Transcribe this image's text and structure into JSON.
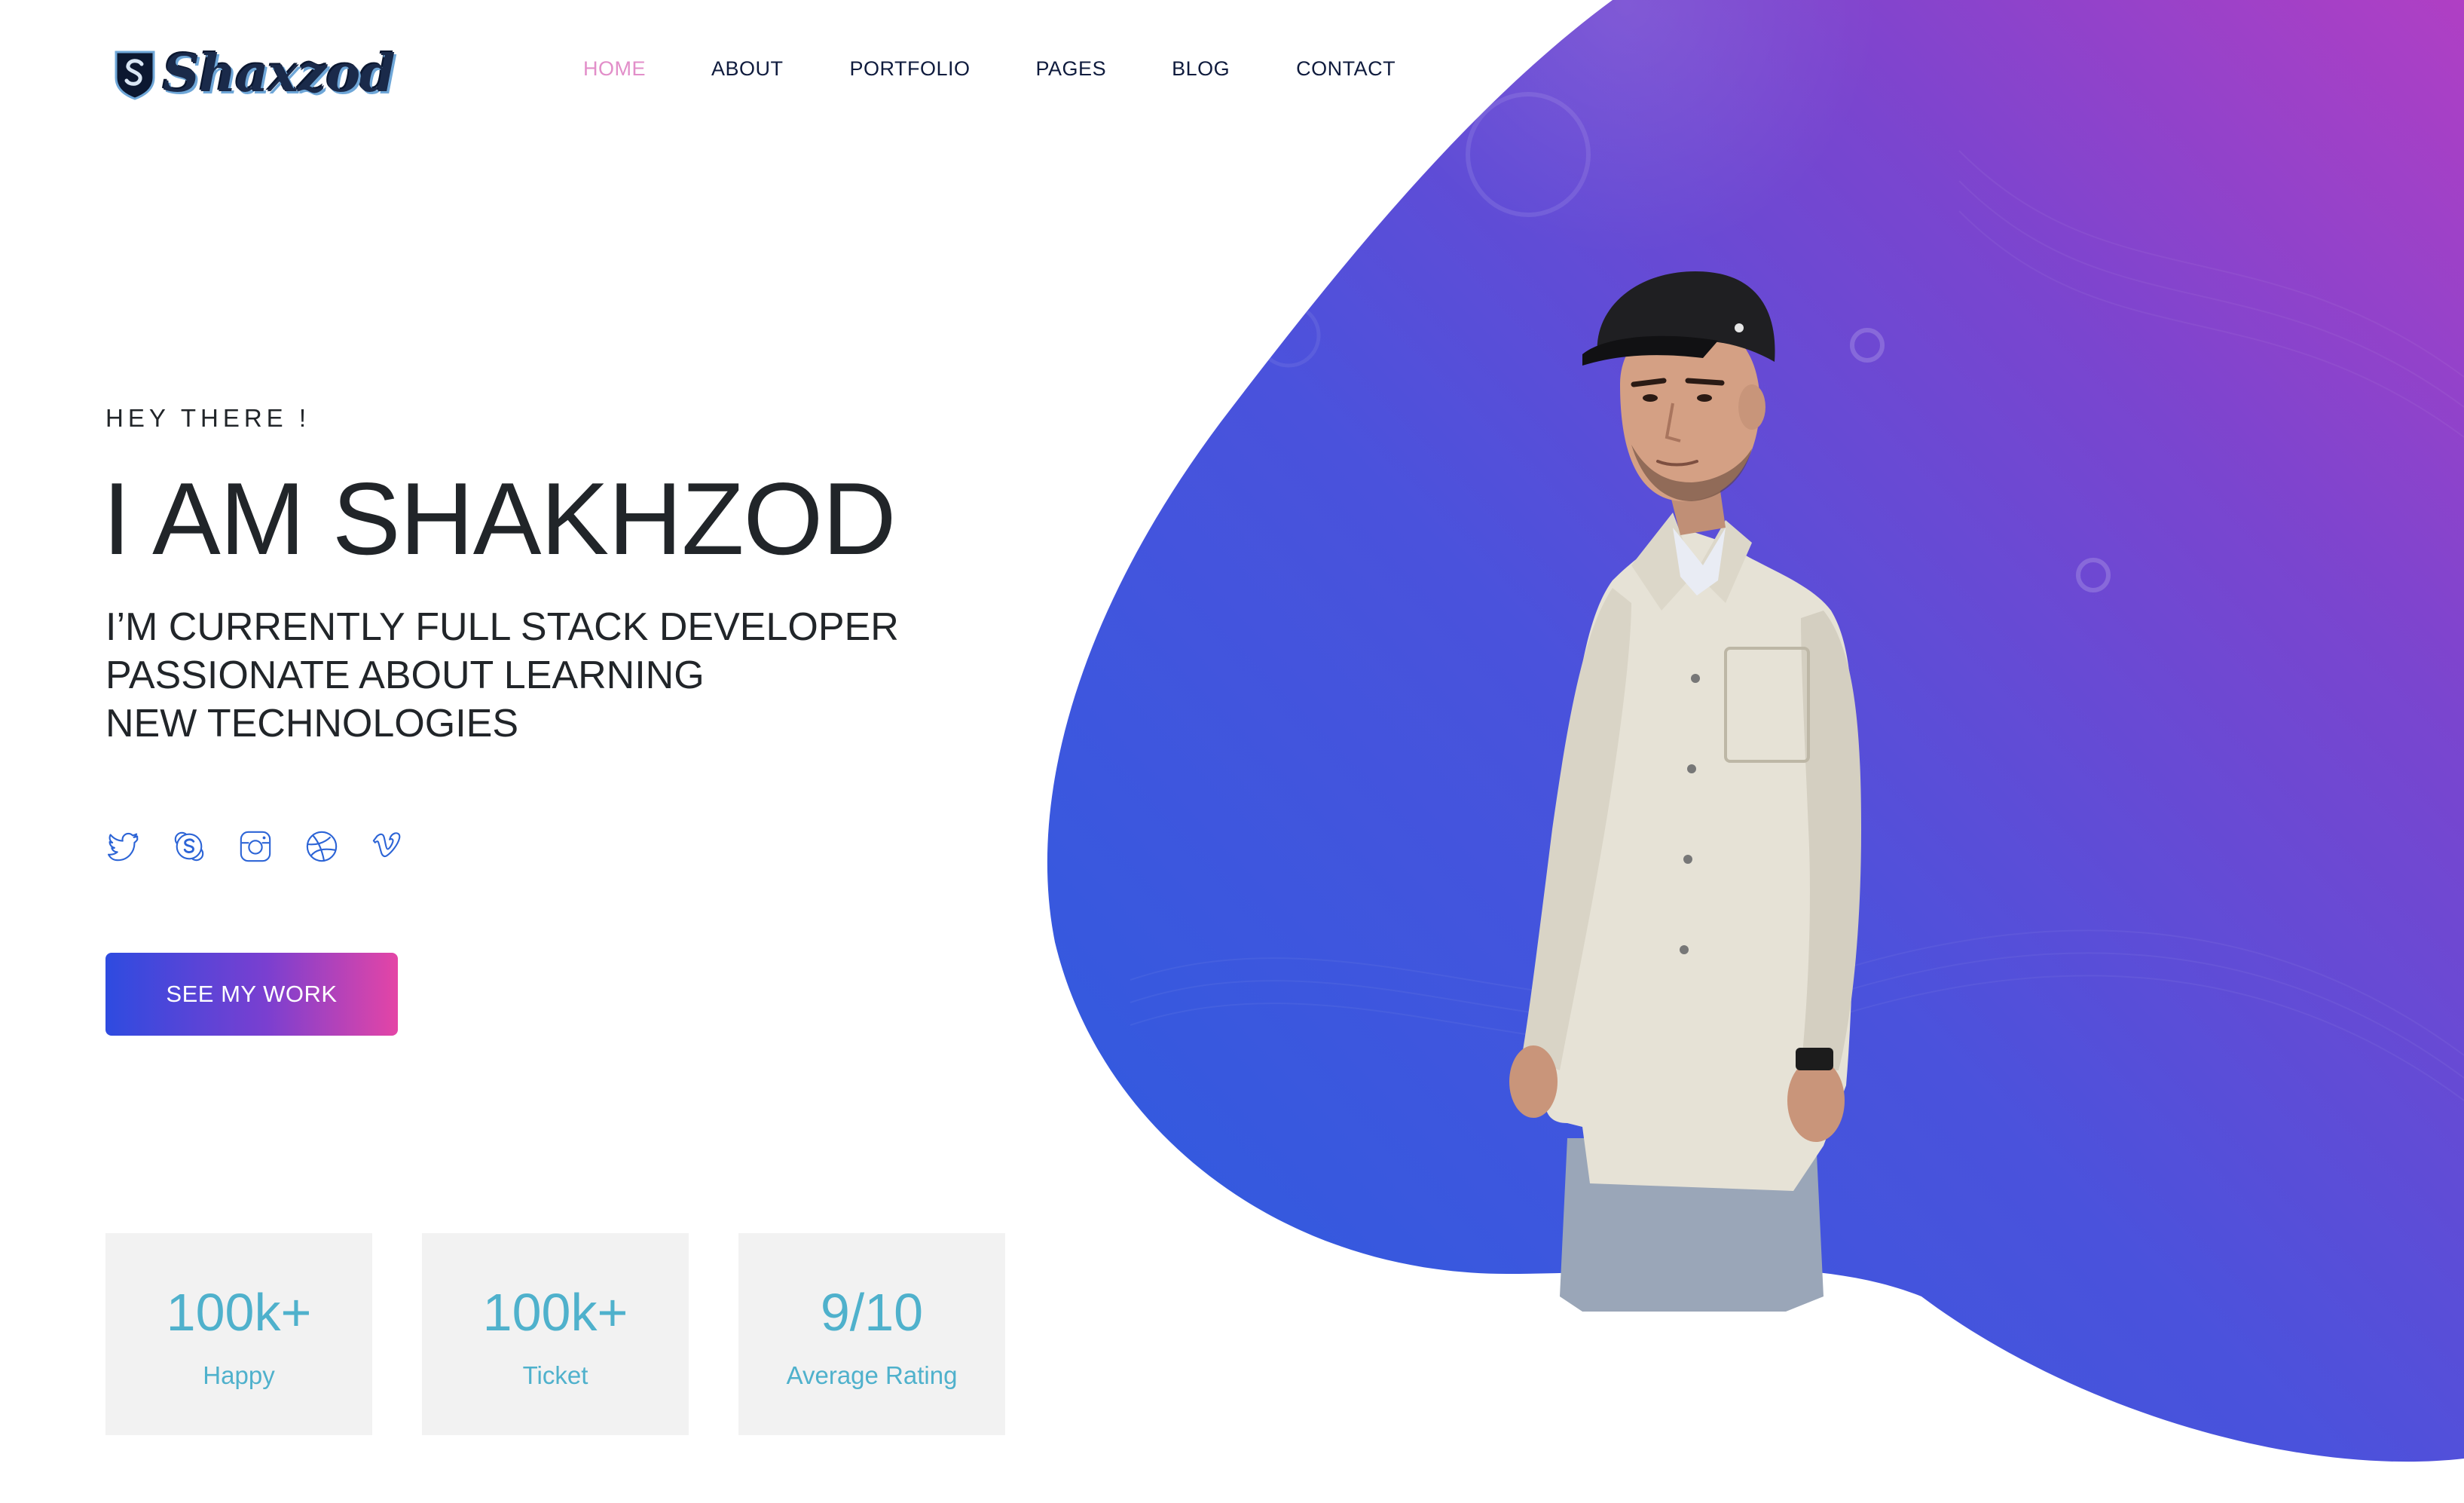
{
  "brand": {
    "name": "Shaxzod",
    "colors": {
      "accent_pink": "#e28ec9",
      "gradient_start": "#2a5de0",
      "gradient_end": "#b03fc4",
      "stat_text": "#4fb1cc",
      "stat_bg": "#f2f2f2"
    }
  },
  "nav": {
    "items": [
      {
        "label": "HOME",
        "active": true
      },
      {
        "label": "ABOUT"
      },
      {
        "label": "PORTFOLIO"
      },
      {
        "label": "PAGES"
      },
      {
        "label": "BLOG"
      },
      {
        "label": "CONTACT"
      }
    ]
  },
  "hero": {
    "eyebrow": "HEY THERE !",
    "headline": "I AM SHAKHZOD",
    "tagline": [
      "I’M CURRENTLY FULL STACK DEVELOPER",
      "PASSIONATE ABOUT LEARNING",
      "NEW TECHNOLOGIES"
    ],
    "cta_label": "SEE MY WORK"
  },
  "socials": [
    {
      "icon": "twitter-icon"
    },
    {
      "icon": "skype-icon"
    },
    {
      "icon": "instagram-icon"
    },
    {
      "icon": "dribbble-icon"
    },
    {
      "icon": "vimeo-icon"
    }
  ],
  "stats": [
    {
      "value": "100k+",
      "label": "Happy"
    },
    {
      "value": "100k+",
      "label": "Ticket"
    },
    {
      "value": "9/10",
      "label": "Average Rating"
    }
  ]
}
